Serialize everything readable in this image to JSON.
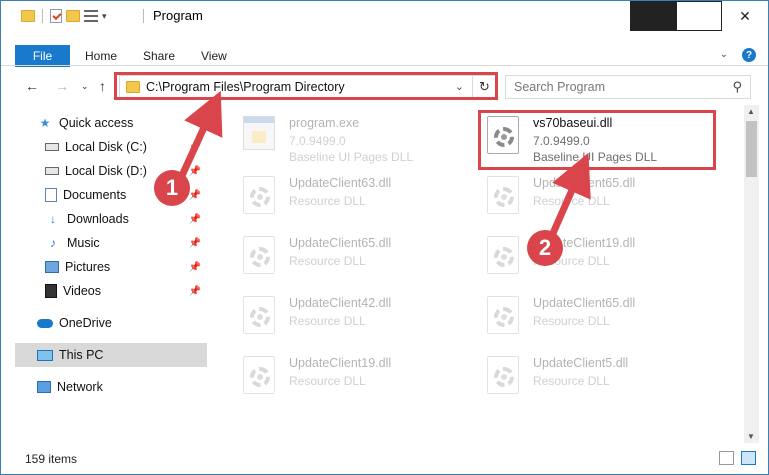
{
  "window": {
    "title": "Program"
  },
  "ribbon": {
    "file": "File",
    "home": "Home",
    "share": "Share",
    "view": "View"
  },
  "address": {
    "path": "C:\\Program Files\\Program Directory"
  },
  "search": {
    "placeholder": "Search Program"
  },
  "sidebar": {
    "items": [
      {
        "label": "Quick access",
        "icon": "quick-access-star-icon"
      },
      {
        "label": "Local Disk (C:)",
        "icon": "drive-icon",
        "pinned": true
      },
      {
        "label": "Local Disk (D:)",
        "icon": "drive-icon",
        "pinned": true
      },
      {
        "label": "Documents",
        "icon": "documents-icon",
        "pinned": true
      },
      {
        "label": "Downloads",
        "icon": "download-arrow-icon",
        "pinned": true
      },
      {
        "label": "Music",
        "icon": "music-note-icon",
        "pinned": true
      },
      {
        "label": "Pictures",
        "icon": "pictures-icon",
        "pinned": true
      },
      {
        "label": "Videos",
        "icon": "videos-icon",
        "pinned": true
      },
      {
        "label": "OneDrive",
        "icon": "cloud-icon"
      },
      {
        "label": "This PC",
        "icon": "computer-icon",
        "selected": true
      },
      {
        "label": "Network",
        "icon": "network-icon"
      }
    ]
  },
  "files": [
    {
      "name": "program.exe",
      "line1": "7.0.9499.0",
      "line2": "Baseline UI Pages DLL",
      "type": "exe",
      "faded": true
    },
    {
      "name": "vs70baseui.dll",
      "line1": "7.0.9499.0",
      "line2": "Baseline UI Pages DLL",
      "type": "dll",
      "faded": false
    },
    {
      "name": "UpdateClient63.dll",
      "line1": "Resource DLL",
      "line2": "",
      "type": "dll",
      "faded": true
    },
    {
      "name": "UpdateClient65.dll",
      "line1": "Resource DLL",
      "line2": "",
      "type": "dll",
      "faded": true
    },
    {
      "name": "UpdateClient65.dll",
      "line1": "Resource DLL",
      "line2": "",
      "type": "dll",
      "faded": true
    },
    {
      "name": "UpdateClient19.dll",
      "line1": "Resource DLL",
      "line2": "",
      "type": "dll",
      "faded": true
    },
    {
      "name": "UpdateClient42.dll",
      "line1": "Resource DLL",
      "line2": "",
      "type": "dll",
      "faded": true
    },
    {
      "name": "UpdateClient65.dll",
      "line1": "Resource DLL",
      "line2": "",
      "type": "dll",
      "faded": true
    },
    {
      "name": "UpdateClient19.dll",
      "line1": "Resource DLL",
      "line2": "",
      "type": "dll",
      "faded": true
    },
    {
      "name": "UpdateClient5.dll",
      "line1": "Resource DLL",
      "line2": "",
      "type": "dll",
      "faded": true
    }
  ],
  "status": {
    "count": "159 items"
  },
  "annotations": {
    "step1": "1",
    "step2": "2",
    "color": "#d9454b"
  },
  "colors": {
    "accent": "#1979ca",
    "highlight": "#d9454b",
    "selected": "#d9d9d9"
  }
}
